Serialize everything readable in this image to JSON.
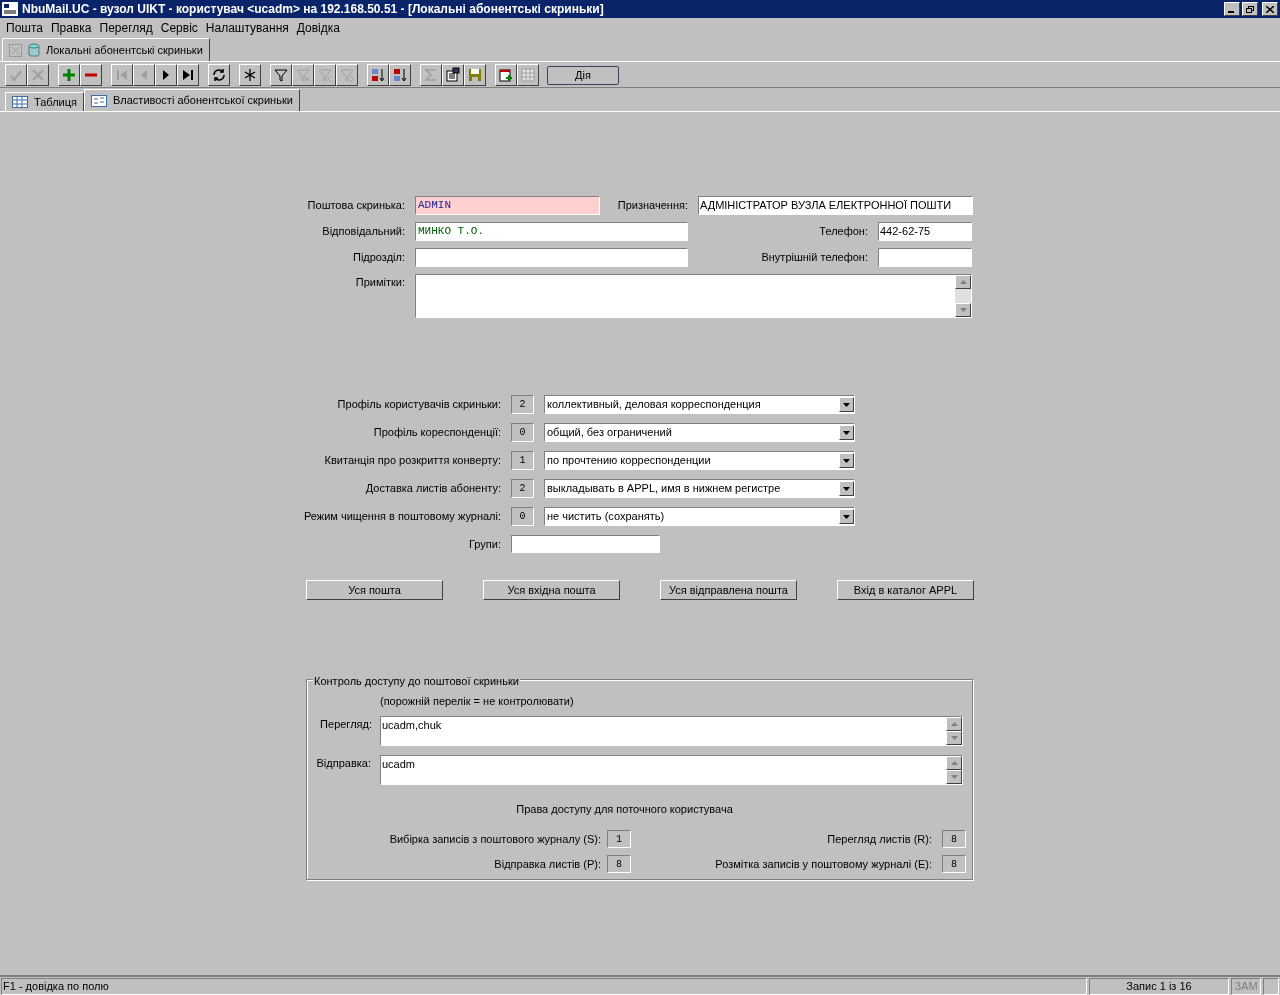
{
  "window": {
    "title": "NbuMail.UC - вузол UIKT - користувач <ucadm> на 192.168.50.51 - [Локальні абонентські скриньки]"
  },
  "menu": [
    "Пошта",
    "Правка",
    "Перегляд",
    "Сервіс",
    "Налаштування",
    "Довідка"
  ],
  "document_tab": {
    "label": "Локальні абонентські скриньки"
  },
  "toolbar": [
    {
      "kind": "check",
      "disabled": true
    },
    {
      "kind": "cancel",
      "disabled": true
    },
    {
      "kind": "gap"
    },
    {
      "kind": "add",
      "disabled": false
    },
    {
      "kind": "remove",
      "disabled": false
    },
    {
      "kind": "gap"
    },
    {
      "kind": "first",
      "disabled": true
    },
    {
      "kind": "prev",
      "disabled": true
    },
    {
      "kind": "next",
      "disabled": false
    },
    {
      "kind": "last",
      "disabled": false
    },
    {
      "kind": "gap"
    },
    {
      "kind": "refresh",
      "disabled": false
    },
    {
      "kind": "gap"
    },
    {
      "kind": "asterisk",
      "disabled": false
    },
    {
      "kind": "gap"
    },
    {
      "kind": "filter",
      "disabled": false
    },
    {
      "kind": "filter-clear",
      "disabled": true
    },
    {
      "kind": "filter-prev",
      "disabled": true
    },
    {
      "kind": "filter-next",
      "disabled": true
    },
    {
      "kind": "gap"
    },
    {
      "kind": "sort-asc",
      "disabled": false
    },
    {
      "kind": "sort-desc",
      "disabled": false
    },
    {
      "kind": "gap"
    },
    {
      "kind": "sum",
      "disabled": true
    },
    {
      "kind": "properties",
      "disabled": false
    },
    {
      "kind": "save",
      "disabled": false
    },
    {
      "kind": "gap"
    },
    {
      "kind": "add-record",
      "disabled": false
    },
    {
      "kind": "grid",
      "disabled": true
    }
  ],
  "action_button": {
    "label": "Дія"
  },
  "tabs": [
    {
      "label": "Таблиця",
      "kind": "table",
      "selected": false
    },
    {
      "label": "Властивості абонентської скриньки",
      "kind": "form",
      "selected": true
    }
  ],
  "form": {
    "mailbox": {
      "label": "Поштова скринька:",
      "value": "ADMIN"
    },
    "purpose": {
      "label": "Призначення:",
      "value": "АДМІНІСТРАТОР ВУЗЛА ЕЛЕКТРОННОЇ ПОШТИ"
    },
    "responsible": {
      "label": "Відповідальний:",
      "value": "МИНКО Т.О."
    },
    "phone": {
      "label": "Телефон:",
      "value": "442-62-75"
    },
    "department": {
      "label": "Підрозділ:"
    },
    "internal_phone": {
      "label": "Внутрішній телефон:"
    },
    "notes": {
      "label": "Примітки:"
    },
    "profiles": [
      {
        "label": "Профіль користувачів скриньки:",
        "code": "2",
        "value": "коллективный, деловая корреспонденция"
      },
      {
        "label": "Профіль кореспонденції:",
        "code": "0",
        "value": "общий, без ограничений"
      },
      {
        "label": "Квитанція про розкриття конверту:",
        "code": "1",
        "value": "по прочтению корреспонденции"
      },
      {
        "label": "Доставка листів абоненту:",
        "code": "2",
        "value": "выкладывать в APPL, имя в нижнем регистре"
      },
      {
        "label": "Режим чищення в поштовому журналі:",
        "code": "0",
        "value": "не чистить (сохранять)"
      }
    ],
    "groups": {
      "label": "Групи:"
    },
    "buttons": [
      "Уся пошта",
      "Уся вхідна пошта",
      "Уся відправлена пошта",
      "Вхід в каталог APPL"
    ]
  },
  "access": {
    "title": "Контроль доступу до поштової скриньки",
    "hint": "(порожній перелік = не контролювати)",
    "view": {
      "label": "Перегляд:",
      "value": "ucadm,chuk"
    },
    "send": {
      "label": "Відправка:",
      "value": "ucadm"
    },
    "rights_title": "Права доступу для поточного користувача",
    "rights": [
      {
        "label": "Вибірка записів з поштового журналу (S):",
        "value": "1"
      },
      {
        "label": "Перегляд листів (R):",
        "value": "8"
      },
      {
        "label": "Відправка листів (P):",
        "value": "8"
      },
      {
        "label": "Розмітка записів у поштовому журналі (E):",
        "value": "8"
      }
    ]
  },
  "status_bar": {
    "hint": "F1 - довідка по полю",
    "record": "Запис 1 із 16",
    "caps": "ЗАМ"
  }
}
